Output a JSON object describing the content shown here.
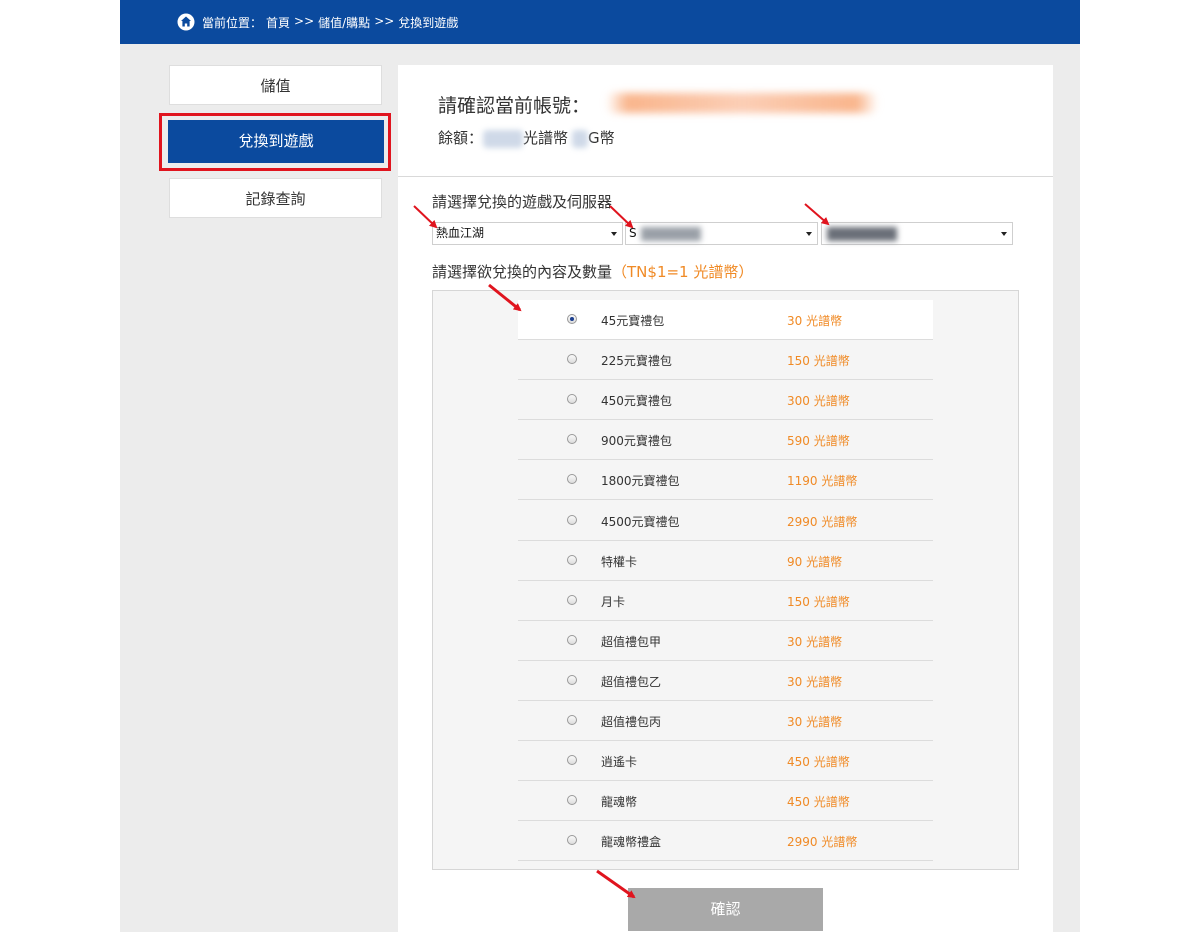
{
  "topbar": {
    "breadcrumb": [
      "當前位置：",
      "首頁",
      ">>",
      "儲值/購點",
      ">>",
      "兌換到遊戲"
    ]
  },
  "sidebar": {
    "items": [
      {
        "label": "儲值"
      },
      {
        "label": "兌換到遊戲"
      },
      {
        "label": "記錄查詢"
      }
    ]
  },
  "account": {
    "title": "請確認當前帳號：",
    "balance_prefix": "餘額：",
    "balance_unit1": "光譜幣",
    "balance_unit2": "G幣"
  },
  "selectors": {
    "label": "請選擇兌換的遊戲及伺服器",
    "game": "熱血江湖",
    "server_prefix": "S"
  },
  "items_section": {
    "label": "請選擇欲兌換的內容及數量",
    "rate": "（TN$1=1 光譜幣）"
  },
  "items": [
    {
      "name": "45元寶禮包",
      "price": "30 光譜幣",
      "selected": true
    },
    {
      "name": "225元寶禮包",
      "price": "150 光譜幣"
    },
    {
      "name": "450元寶禮包",
      "price": "300 光譜幣"
    },
    {
      "name": "900元寶禮包",
      "price": "590 光譜幣"
    },
    {
      "name": "1800元寶禮包",
      "price": "1190 光譜幣"
    },
    {
      "name": "4500元寶禮包",
      "price": "2990 光譜幣"
    },
    {
      "name": "特權卡",
      "price": "90 光譜幣"
    },
    {
      "name": "月卡",
      "price": "150 光譜幣"
    },
    {
      "name": "超值禮包甲",
      "price": "30 光譜幣"
    },
    {
      "name": "超值禮包乙",
      "price": "30 光譜幣"
    },
    {
      "name": "超值禮包丙",
      "price": "30 光譜幣"
    },
    {
      "name": "逍遙卡",
      "price": "450 光譜幣"
    },
    {
      "name": "龍魂幣",
      "price": "450 光譜幣"
    },
    {
      "name": "龍魂幣禮盒",
      "price": "2990 光譜幣"
    }
  ],
  "confirm_label": "確認",
  "colors": {
    "brand_blue": "#0b4a9e",
    "highlight_red": "#e0141e",
    "price_orange": "#f08a25",
    "disabled_gray": "#a9a9a9"
  },
  "icons": [
    "home-icon",
    "dropdown-caret-icon",
    "annotation-arrow-icon"
  ]
}
